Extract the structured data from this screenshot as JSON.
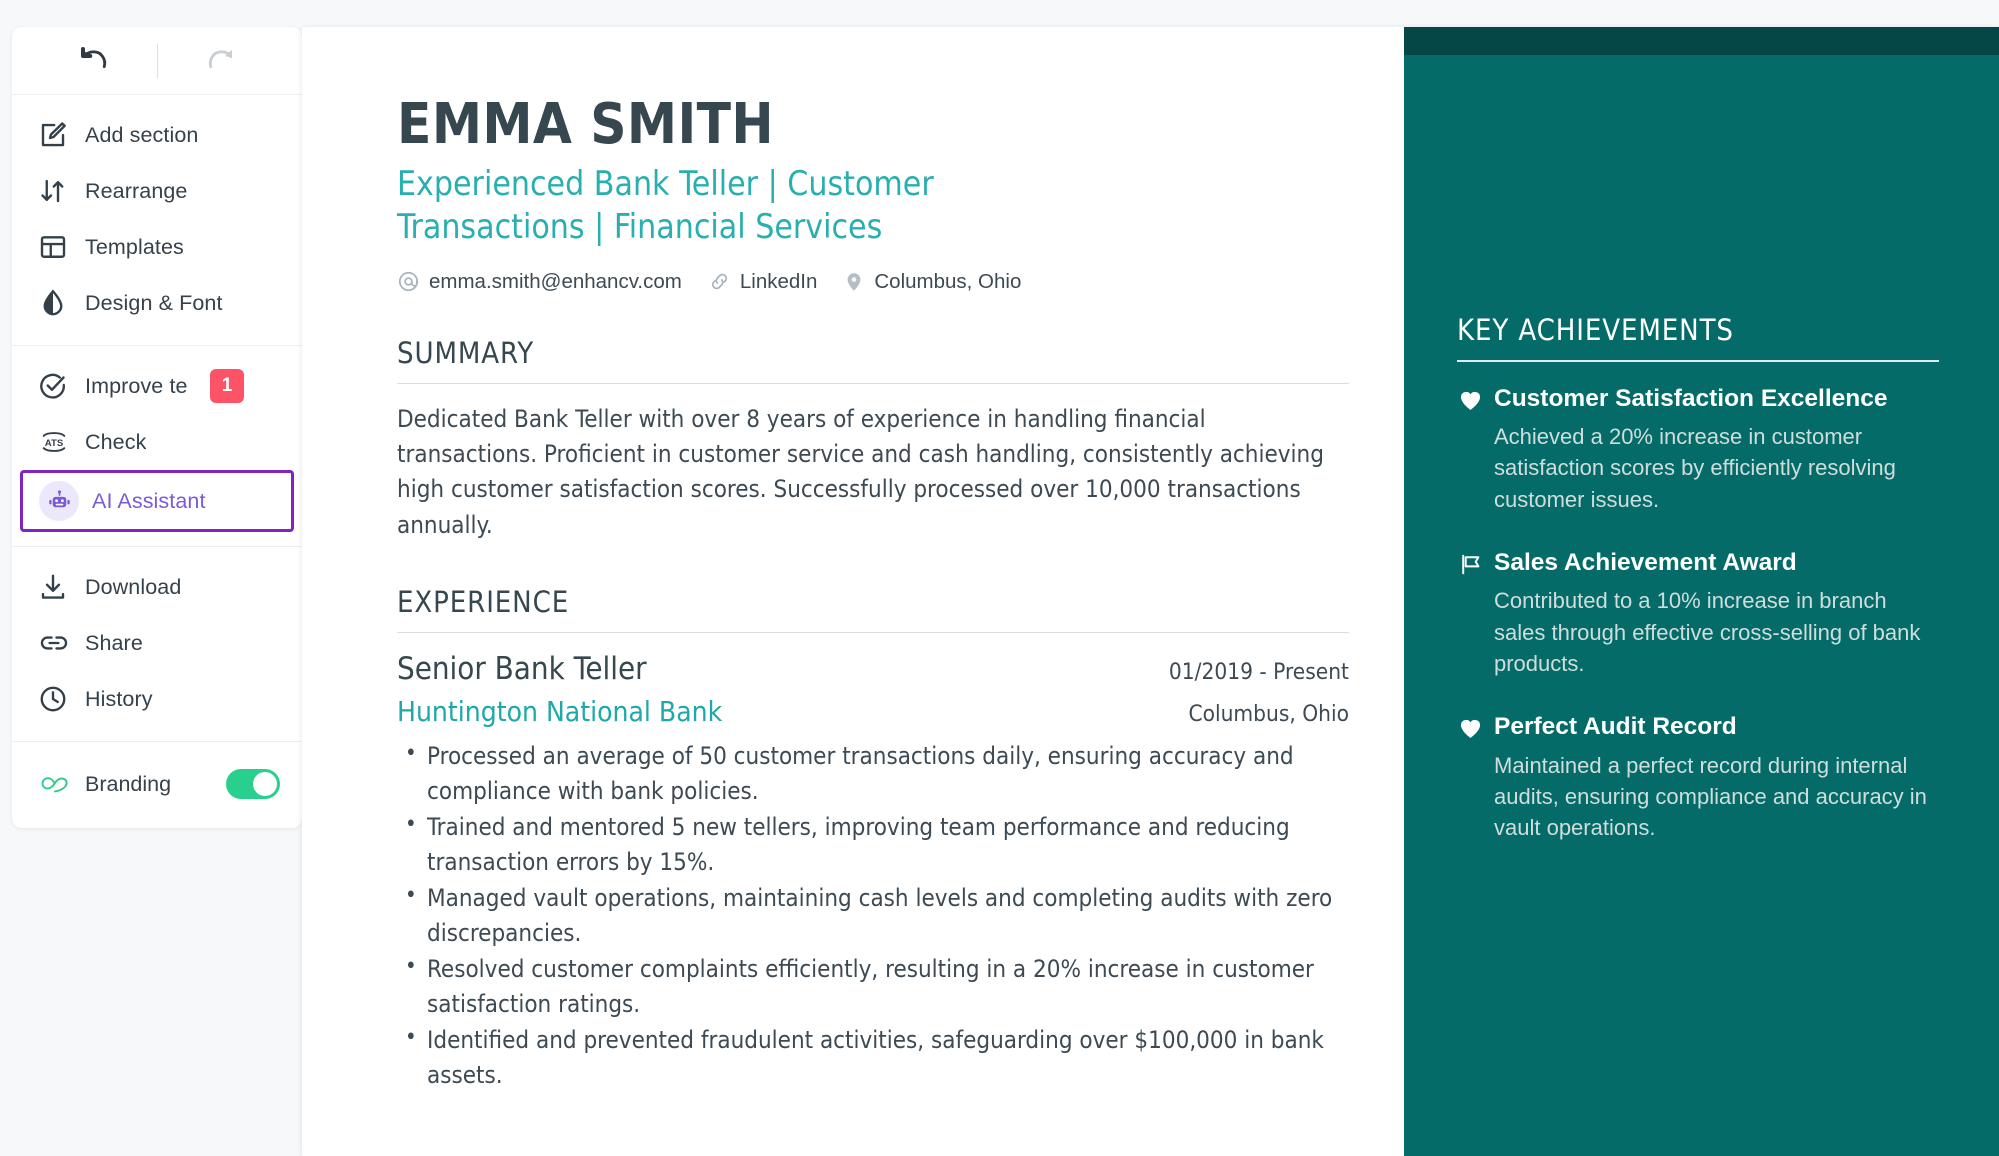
{
  "sidebar": {
    "undo_label": "undo",
    "redo_label": "redo",
    "groups": [
      {
        "items": [
          {
            "icon": "edit-square-icon",
            "label": "Add section"
          },
          {
            "icon": "rearrange-arrows-icon",
            "label": "Rearrange"
          },
          {
            "icon": "templates-layout-icon",
            "label": "Templates"
          },
          {
            "icon": "design-font-droplet-icon",
            "label": "Design & Font"
          }
        ]
      },
      {
        "items": [
          {
            "icon": "check-circle-icon",
            "label": "Improve te",
            "badge": "1",
            "truncated": true
          },
          {
            "icon": "ats-icon",
            "label": "Check"
          },
          {
            "icon": "robot-icon",
            "label": "AI Assistant",
            "active": true
          }
        ]
      },
      {
        "items": [
          {
            "icon": "download-icon",
            "label": "Download"
          },
          {
            "icon": "link-share-icon",
            "label": "Share"
          },
          {
            "icon": "clock-history-icon",
            "label": "History"
          }
        ]
      }
    ],
    "branding": {
      "icon": "enhancv-infinity-logo-icon",
      "label": "Branding",
      "toggle_on": true
    },
    "colors": {
      "badge": "#fc5366",
      "active_border": "#8023bf",
      "active_text": "#7b5ad9",
      "toggle_on": "#28cf8d"
    }
  },
  "resume": {
    "name": "EMMA SMITH",
    "headline": "Experienced Bank Teller | Customer Transactions | Financial Services",
    "contacts": [
      {
        "icon": "at-email-icon",
        "text": "emma.smith@enhancv.com"
      },
      {
        "icon": "link-chain-icon",
        "text": "LinkedIn"
      },
      {
        "icon": "map-pin-icon",
        "text": "Columbus, Ohio"
      }
    ],
    "summary": {
      "title": "SUMMARY",
      "text": "Dedicated Bank Teller with over 8 years of experience in handling financial transactions. Proficient in customer service and cash handling, consistently achieving high customer satisfaction scores. Successfully processed over 10,000 transactions annually."
    },
    "experience": {
      "title": "EXPERIENCE",
      "jobs": [
        {
          "title": "Senior Bank Teller",
          "dates": "01/2019 - Present",
          "company": "Huntington National Bank",
          "location": "Columbus, Ohio",
          "bullets": [
            "Processed an average of 50 customer transactions daily, ensuring accuracy and compliance with bank policies.",
            "Trained and mentored 5 new tellers, improving team performance and reducing transaction errors by 15%.",
            "Managed vault operations, maintaining cash levels and completing audits with zero discrepancies.",
            "Resolved customer complaints efficiently, resulting in a 20% increase in customer satisfaction ratings.",
            "Identified and prevented fraudulent activities, safeguarding over $100,000 in bank assets."
          ]
        }
      ]
    },
    "key_achievements": {
      "title": "KEY ACHIEVEMENTS",
      "items": [
        {
          "icon": "heart-icon",
          "heading": "Customer Satisfaction Excellence",
          "description": "Achieved a 20% increase in customer satisfaction scores by efficiently resolving customer issues."
        },
        {
          "icon": "flag-icon",
          "heading": "Sales Achievement Award",
          "description": "Contributed to a 10% increase in branch sales through effective cross-selling of bank products."
        },
        {
          "icon": "heart-icon",
          "heading": "Perfect Audit Record",
          "description": "Maintained a perfect record during internal audits, ensuring compliance and accuracy in vault operations."
        }
      ]
    },
    "colors": {
      "accent_teal": "#2aafb0",
      "company_teal": "#1fa8a8",
      "panel_teal": "#046b68",
      "panel_teal_dark": "#054746",
      "heading_dark": "#37474f"
    }
  }
}
